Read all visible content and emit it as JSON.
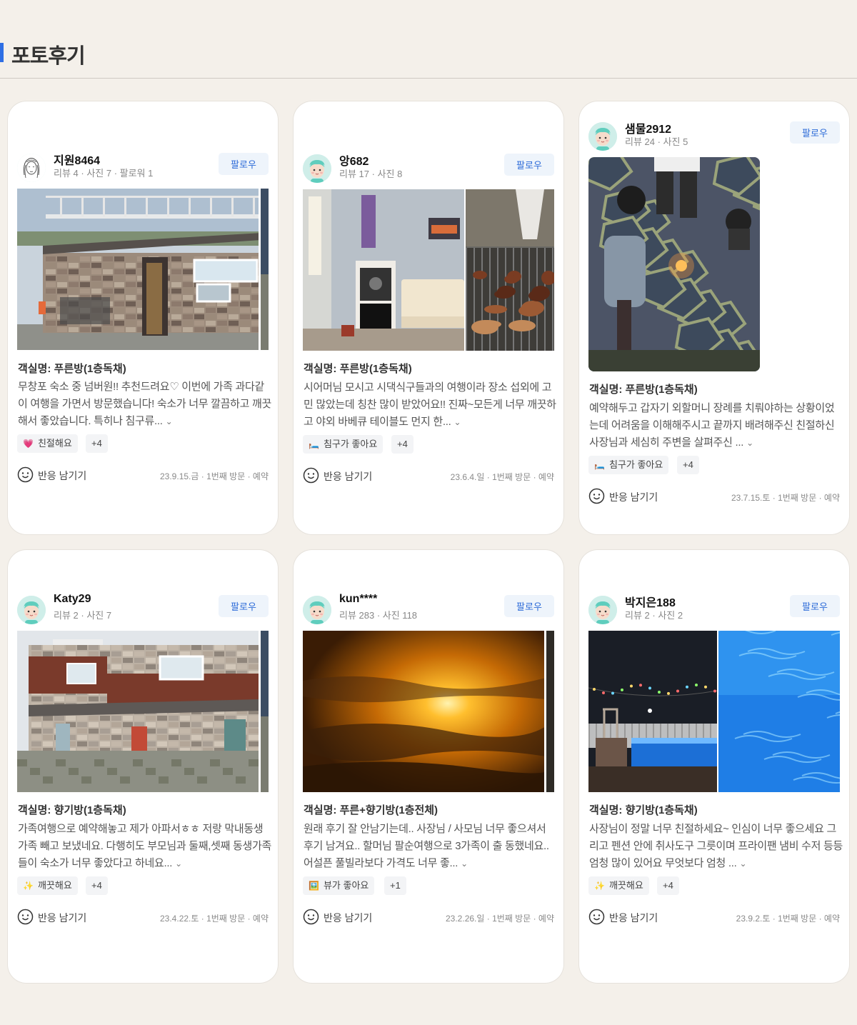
{
  "page": {
    "title": "포토후기",
    "accent_color": "#2f6fe4",
    "follow_label": "팔로우",
    "react_label": "반응 남기기"
  },
  "reviews": [
    {
      "user": "지원8464",
      "stats": "리뷰 4 · 사진 7 · 팔로워 1",
      "avatar": "sketch-face-avatar",
      "room": "객실명: 푸른방(1층독채)",
      "text": "무창포 숙소 중 넘버원!! 추천드려요♡ 이번에 가족 과다같이 여행을 가면서 방문했습니다! 숙소가 너무 깔끔하고 깨끗해서 좋았습니다. 특히나 침구류...",
      "tag": {
        "emoji": "💗",
        "icon": "heart-icon",
        "label": "친절해요"
      },
      "tag_more": "+4",
      "meta": "23.9.15.금 · 1번째 방문 · 예약",
      "photos": [
        "house-brick-exterior",
        "house-side-strip"
      ]
    },
    {
      "user": "앙682",
      "stats": "리뷰 17 · 사진 8",
      "avatar": "default-mint-avatar",
      "room": "객실명: 푸른방(1층독채)",
      "text": "시어머님 모시고 시댁식구들과의 여행이라 장소 섭외에 고민 많았는데 칭찬 많이 받았어요!! 진짜~모든게 너무 깨끗하고 야외 바베큐 테이블도 먼지 한...",
      "tag": {
        "emoji": "🛏️",
        "icon": "bed-icon",
        "label": "침구가 좋아요"
      },
      "tag_more": "+4",
      "meta": "23.6.4.일 · 1번째 방문 · 예약",
      "photos": [
        "karaoke-room",
        "bbq-grill"
      ]
    },
    {
      "user": "샘물2912",
      "stats": "리뷰 24 · 사진 5",
      "avatar": "default-mint-avatar",
      "room": "객실명: 푸른방(1층독채)",
      "text": "예약해두고 갑자기 외할머니 장례를 치뤄야하는 상황이었는데 어려움을 이해해주시고 끝까지 배려해주신 친절하신 사장님과 세심히 주변을 살펴주신 ...",
      "tag": {
        "emoji": "🛏️",
        "icon": "bed-icon",
        "label": "침구가 좋아요"
      },
      "tag_more": "+4",
      "meta": "23.7.15.토 · 1번째 방문 · 예약",
      "photos": [
        "kids-sparkler-night"
      ]
    },
    {
      "user": "Katy29",
      "stats": "리뷰 2 · 사진 7",
      "avatar": "default-mint-avatar",
      "room": "객실명: 향기방(1층독채)",
      "text": "가족여행으로 예약해놓고 제가 아파서ㅎㅎ 저랑 막내동생가족 빼고 보냈네요. 다행히도 부모님과 둘째,셋째 동생가족들이 숙소가 너무 좋았다고 하네요...",
      "tag": {
        "emoji": "✨",
        "icon": "sparkle-icon",
        "label": "깨끗해요"
      },
      "tag_more": "+4",
      "meta": "23.4.22.토 · 1번째 방문 · 예약",
      "photos": [
        "two-story-pension",
        "house-side-strip"
      ]
    },
    {
      "user": "kun****",
      "stats": "리뷰 283 · 사진 118",
      "avatar": "default-mint-avatar",
      "room": "객실명: 푸른+향기방(1층전체)",
      "text": "원래 후기 잘 안남기는데.. 사장님 / 사모님 너무 좋으셔서 후기 남겨요.. 할머님 팔순여행으로 3가족이 출 동했네요.. 어설픈 풀빌라보다 가격도 너무 좋...",
      "tag": {
        "emoji": "🖼️",
        "icon": "picture-icon",
        "label": "뷰가 좋아요"
      },
      "tag_more": "+1",
      "meta": "23.2.26.일 · 1번째 방문 · 예약",
      "photos": [
        "sunset-clouds",
        "dark-strip"
      ]
    },
    {
      "user": "박지은188",
      "stats": "리뷰 2 · 사진 2",
      "avatar": "default-mint-avatar",
      "room": "객실명: 향기방(1층독채)",
      "text": "사장님이 정말 너무 친절하세요~ 인심이 너무 좋으세요 그리고 펜션 안에 취사도구 그릇이며 프라이팬 냄비 수저 등등 엄청 많이 있어요 무엇보다 엄청 ...",
      "tag": {
        "emoji": "✨",
        "icon": "sparkle-icon",
        "label": "깨끗해요"
      },
      "tag_more": "+4",
      "meta": "23.9.2.토 · 1번째 방문 · 예약",
      "photos": [
        "pool-night-lights",
        "pool-water-closeup"
      ]
    }
  ]
}
